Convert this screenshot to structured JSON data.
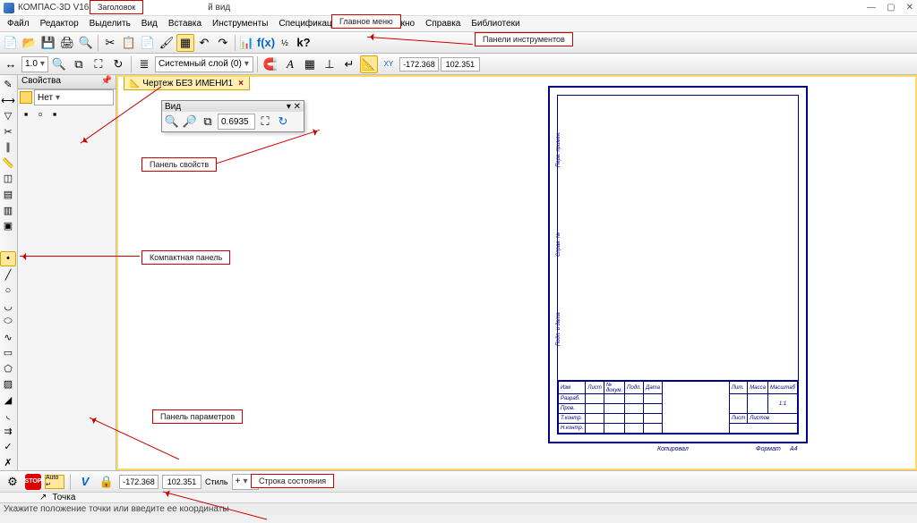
{
  "title": "КОМПАС-3D V16.1 x64 - Ч",
  "title_suffix": "й вид",
  "menu": [
    "Файл",
    "Редактор",
    "Выделить",
    "Вид",
    "Вставка",
    "Инструменты",
    "Спецификация",
    "Сервис",
    "Окно",
    "Справка",
    "Библиотеки"
  ],
  "toolbar2": {
    "layer": "Системный слой (0)",
    "num": "1.0"
  },
  "prop": {
    "title": "Свойства",
    "pin": "📌",
    "filter": "Нет"
  },
  "tab": {
    "name": "Чертеж БЕЗ ИМЕНИ1"
  },
  "vid": {
    "title": "Вид",
    "zoom": "0.6935"
  },
  "coords": {
    "x": "-172.368",
    "y": "102.351"
  },
  "callouts": {
    "title": "Заголовок",
    "menu": "Главное меню",
    "tools": "Панели инструментов",
    "props": "Панель свойств",
    "compact": "Компактная панель",
    "params": "Панель параметров",
    "status": "Строка состояния"
  },
  "stamp": {
    "r1": [
      "Изм",
      "Лист",
      "№ докум.",
      "Подп.",
      "Дата"
    ],
    "r2": [
      "Разраб."
    ],
    "r3": [
      "Пров."
    ],
    "r4": [
      "Т.контр."
    ],
    "r5": [
      "Н.контр."
    ],
    "lit": "Лит.",
    "mass": "Масса",
    "scale": "Масштаб",
    "val": "1:1",
    "list": "Лист",
    "lists": "Листов"
  },
  "bottom": {
    "kopir": "Копировал",
    "fmt": "Формат",
    "a4": "А4"
  },
  "params_bar": {
    "style": "Стиль",
    "plus": "+"
  },
  "status2": {
    "pt": "Точка"
  },
  "status3": "Укажите положение точки или введите ее координаты"
}
